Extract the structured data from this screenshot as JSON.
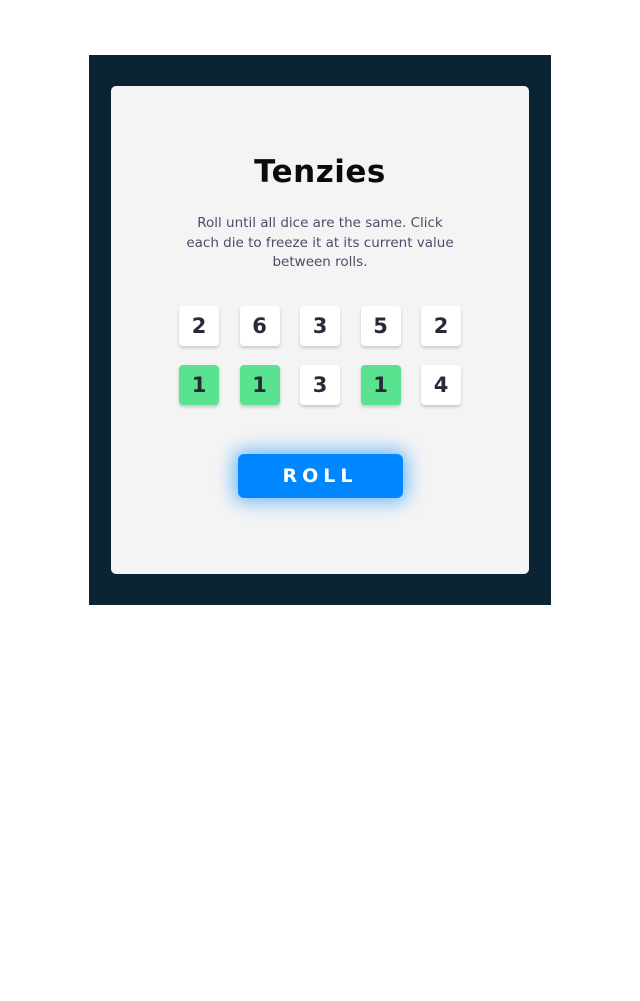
{
  "game": {
    "title": "Tenzies",
    "instructions": "Roll until all dice are the same. Click each die to freeze it at its current value between rolls.",
    "roll_label": "ROLL"
  },
  "colors": {
    "frame_bg": "#0b2434",
    "card_bg": "#f4f4f4",
    "die_bg": "#ffffff",
    "die_held_bg": "#59e391",
    "button_bg": "#0087ff"
  },
  "dice": [
    {
      "value": "2",
      "held": false
    },
    {
      "value": "6",
      "held": false
    },
    {
      "value": "3",
      "held": false
    },
    {
      "value": "5",
      "held": false
    },
    {
      "value": "2",
      "held": false
    },
    {
      "value": "1",
      "held": true
    },
    {
      "value": "1",
      "held": true
    },
    {
      "value": "3",
      "held": false
    },
    {
      "value": "1",
      "held": true
    },
    {
      "value": "4",
      "held": false
    }
  ]
}
